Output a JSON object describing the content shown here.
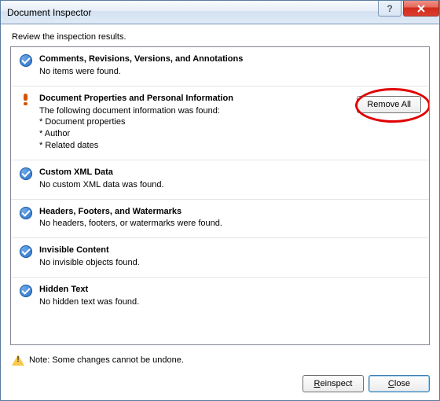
{
  "window_title": "Document Inspector",
  "instruction": "Review the inspection results.",
  "sections": [
    {
      "icon": "check",
      "title": "Comments, Revisions, Versions, and Annotations",
      "detail": "No items were found.",
      "action": null
    },
    {
      "icon": "warn",
      "title": "Document Properties and Personal Information",
      "detail": "The following document information was found:\n* Document properties\n* Author\n* Related dates",
      "action": "Remove All"
    },
    {
      "icon": "check",
      "title": "Custom XML Data",
      "detail": "No custom XML data was found.",
      "action": null
    },
    {
      "icon": "check",
      "title": "Headers, Footers, and Watermarks",
      "detail": "No headers, footers, or watermarks were found.",
      "action": null
    },
    {
      "icon": "check",
      "title": "Invisible Content",
      "detail": "No invisible objects found.",
      "action": null
    },
    {
      "icon": "check",
      "title": "Hidden Text",
      "detail": "No hidden text was found.",
      "action": null
    }
  ],
  "note": "Note: Some changes cannot be undone.",
  "buttons": {
    "reinspect_prefix": "R",
    "reinspect_rest": "einspect",
    "close_prefix": "C",
    "close_rest": "lose"
  },
  "help_glyph": "?"
}
